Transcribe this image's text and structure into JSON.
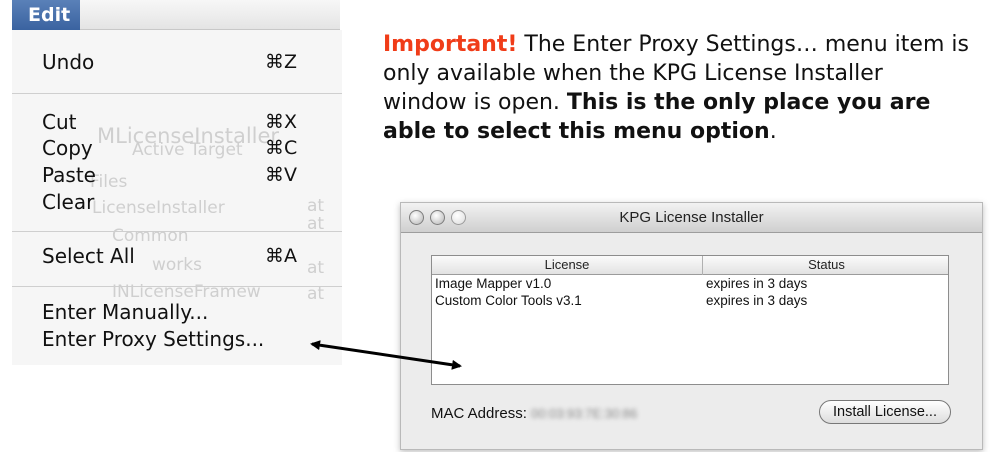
{
  "menu": {
    "title": "Edit",
    "items": [
      {
        "label": "Undo",
        "shortcut": "⌘Z"
      },
      {
        "label": "Cut",
        "shortcut": "⌘X"
      },
      {
        "label": "Copy",
        "shortcut": "⌘C"
      },
      {
        "label": "Paste",
        "shortcut": "⌘V"
      },
      {
        "label": "Clear",
        "shortcut": ""
      },
      {
        "label": "Select All",
        "shortcut": "⌘A"
      },
      {
        "label": "Enter Manually...",
        "shortcut": ""
      },
      {
        "label": "Enter Proxy Settings...",
        "shortcut": ""
      }
    ],
    "background_ghost_text": {
      "installer": "MLicenseInstaller",
      "active_target": "Active Target",
      "files": "Files",
      "license_installer": "LicenseInstaller",
      "common": "Common",
      "works": "works",
      "framew": "INLicenseFramew",
      "at1": "at",
      "at2": "at",
      "at3": "at",
      "at4": "at"
    }
  },
  "callout": {
    "important": "Important!",
    "text1": " The Enter Proxy Settings… menu item is only available when the KPG License Installer window is open. ",
    "bold": "This is the only place you are able to select this menu option",
    "end": "."
  },
  "window": {
    "title": "KPG License Installer",
    "columns": [
      "License",
      "Status"
    ],
    "rows": [
      {
        "license": "Image Mapper v1.0",
        "status": "expires in 3 days"
      },
      {
        "license": "Custom Color Tools v3.1",
        "status": "expires in 3 days"
      }
    ],
    "mac_label": "MAC Address:",
    "mac_value": "00:03:93:7E:30:86",
    "install_button": "Install License..."
  },
  "colors": {
    "important": "#f03c18",
    "menu_title_bg": "#4a72ac"
  }
}
